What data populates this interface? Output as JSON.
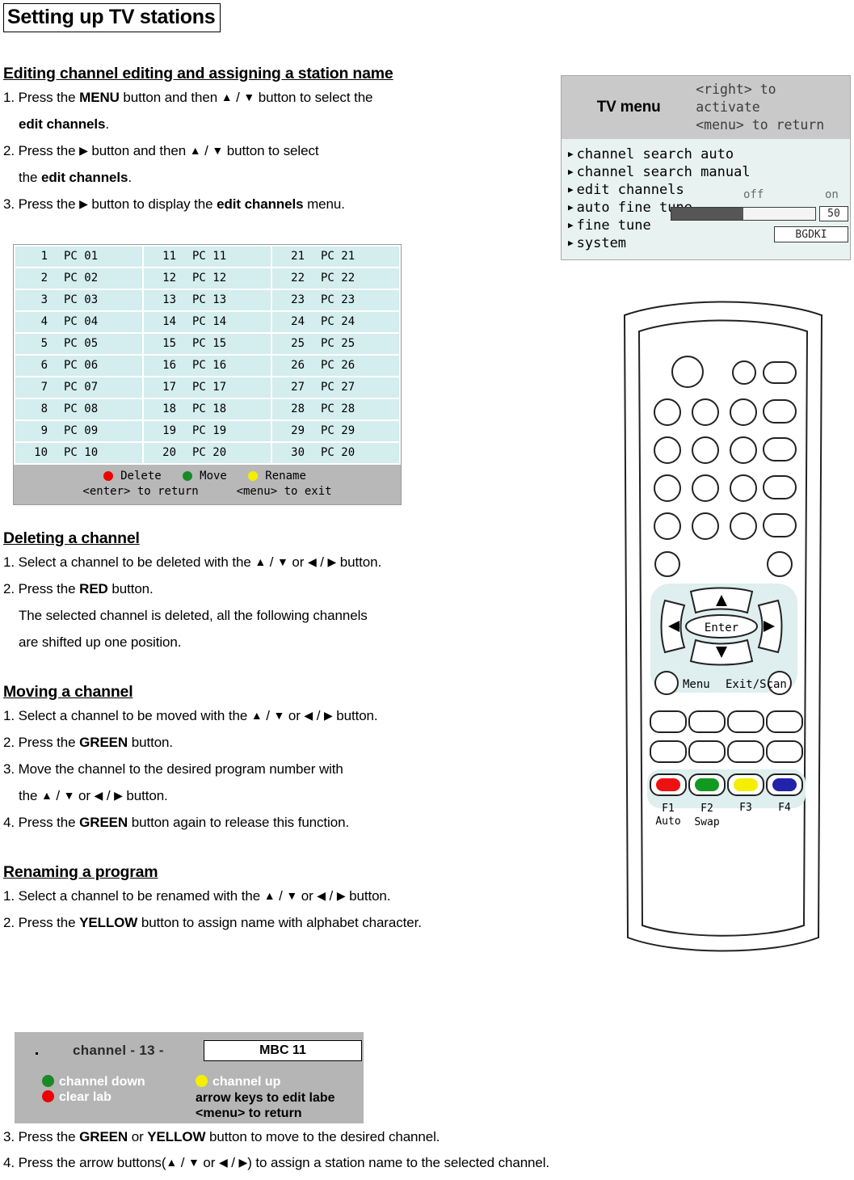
{
  "page_title": "Setting up TV stations",
  "sections": {
    "editing": {
      "heading": "Editing channel editing and assigning a station name",
      "steps": [
        "1. Press the MENU button and then ▲ / ▼ button to select the",
        "edit channels.",
        "2. Press the ▶ button and then ▲ / ▼ button to select",
        "the edit channels.",
        "3. Press the ▶ button to display the edit channels menu."
      ]
    },
    "deleting": {
      "heading": "Deleting a channel",
      "steps": [
        "1. Select a channel to be deleted with the ▲ / ▼ or ◀ / ▶ button.",
        "2. Press the RED button.",
        "The selected channel is deleted, all the following channels",
        "are shifted up one position."
      ]
    },
    "moving": {
      "heading": "Moving a channel",
      "steps": [
        "1. Select a channel to be moved with the ▲ / ▼ or ◀ / ▶ button.",
        "2. Press the GREEN button.",
        "3. Move the channel to the desired program number with",
        "the ▲ / ▼ or ◀ / ▶ button.",
        "4. Press the GREEN button again to release this function."
      ]
    },
    "renaming": {
      "heading": "Renaming a program",
      "steps": [
        "1. Select a channel to be renamed with the ▲ / ▼ or ◀ / ▶ button.",
        "2. Press the YELLOW button to assign name with alphabet character.",
        "3. Press the GREEN or YELLOW button to move to the desired channel.",
        "4. Press the arrow buttons(▲ / ▼ or ◀ / ▶) to assign a station name to the selected channel."
      ]
    }
  },
  "channel_table": {
    "rows": [
      [
        {
          "num": "1",
          "name": "PC 01"
        },
        {
          "num": "11",
          "name": "PC 11"
        },
        {
          "num": "21",
          "name": "PC 21"
        }
      ],
      [
        {
          "num": "2",
          "name": "PC 02"
        },
        {
          "num": "12",
          "name": "PC 12"
        },
        {
          "num": "22",
          "name": "PC 22"
        }
      ],
      [
        {
          "num": "3",
          "name": "PC 03"
        },
        {
          "num": "13",
          "name": "PC 13"
        },
        {
          "num": "23",
          "name": "PC 23"
        }
      ],
      [
        {
          "num": "4",
          "name": "PC 04"
        },
        {
          "num": "14",
          "name": "PC 14"
        },
        {
          "num": "24",
          "name": "PC 24"
        }
      ],
      [
        {
          "num": "5",
          "name": "PC 05"
        },
        {
          "num": "15",
          "name": "PC 15"
        },
        {
          "num": "25",
          "name": "PC 25"
        }
      ],
      [
        {
          "num": "6",
          "name": "PC 06"
        },
        {
          "num": "16",
          "name": "PC 16"
        },
        {
          "num": "26",
          "name": "PC 26"
        }
      ],
      [
        {
          "num": "7",
          "name": "PC 07"
        },
        {
          "num": "17",
          "name": "PC 17"
        },
        {
          "num": "27",
          "name": "PC 27"
        }
      ],
      [
        {
          "num": "8",
          "name": "PC 08"
        },
        {
          "num": "18",
          "name": "PC 18"
        },
        {
          "num": "28",
          "name": "PC 28"
        }
      ],
      [
        {
          "num": "9",
          "name": "PC 09"
        },
        {
          "num": "19",
          "name": "PC 19"
        },
        {
          "num": "29",
          "name": "PC 29"
        }
      ],
      [
        {
          "num": "10",
          "name": "PC 10"
        },
        {
          "num": "20",
          "name": "PC 20"
        },
        {
          "num": "30",
          "name": "PC 20"
        }
      ]
    ],
    "footer": {
      "delete_label": "Delete",
      "move_label": "Move",
      "rename_label": "Rename",
      "enter_hint": "<enter> to return",
      "menu_hint": "<menu> to exit",
      "delete_color": "#ee0000",
      "move_color": "#1a8a26",
      "rename_color": "#f5ee00"
    }
  },
  "tv_menu": {
    "title": "TV menu",
    "hint_line1": "<right> to activate",
    "hint_line2": "<menu> to return",
    "items": [
      {
        "label": "channel search auto"
      },
      {
        "label": "channel search manual"
      },
      {
        "label": "edit channels"
      },
      {
        "label": "auto fine tune"
      },
      {
        "label": "fine tune"
      },
      {
        "label": "system"
      }
    ],
    "auto_fine_tune_off": "off",
    "auto_fine_tune_on": "on",
    "fine_tune_value": "50",
    "fine_tune_percent": 50,
    "system_value": "BGDKI"
  },
  "remote": {
    "enter_label": "Enter",
    "menu_label": "Menu",
    "exit_scan_label": "Exit/Scan",
    "f1_label": "F1",
    "f2_label": "F2",
    "f3_label": "F3",
    "f4_label": "F4",
    "auto_label": "Auto",
    "swap_label": "Swap",
    "f1_color": "#ee1111",
    "f2_color": "#119922",
    "f3_color": "#f5ee00",
    "f4_color": "#2222aa"
  },
  "rename_panel": {
    "channel_text": "channel - 13 -",
    "station_name": "MBC 11",
    "channel_down": "channel down",
    "clear_lab": "clear lab",
    "channel_up": "channel up",
    "arrow_hint1": "arrow keys to edit labe",
    "arrow_hint2": "<menu> to return"
  }
}
